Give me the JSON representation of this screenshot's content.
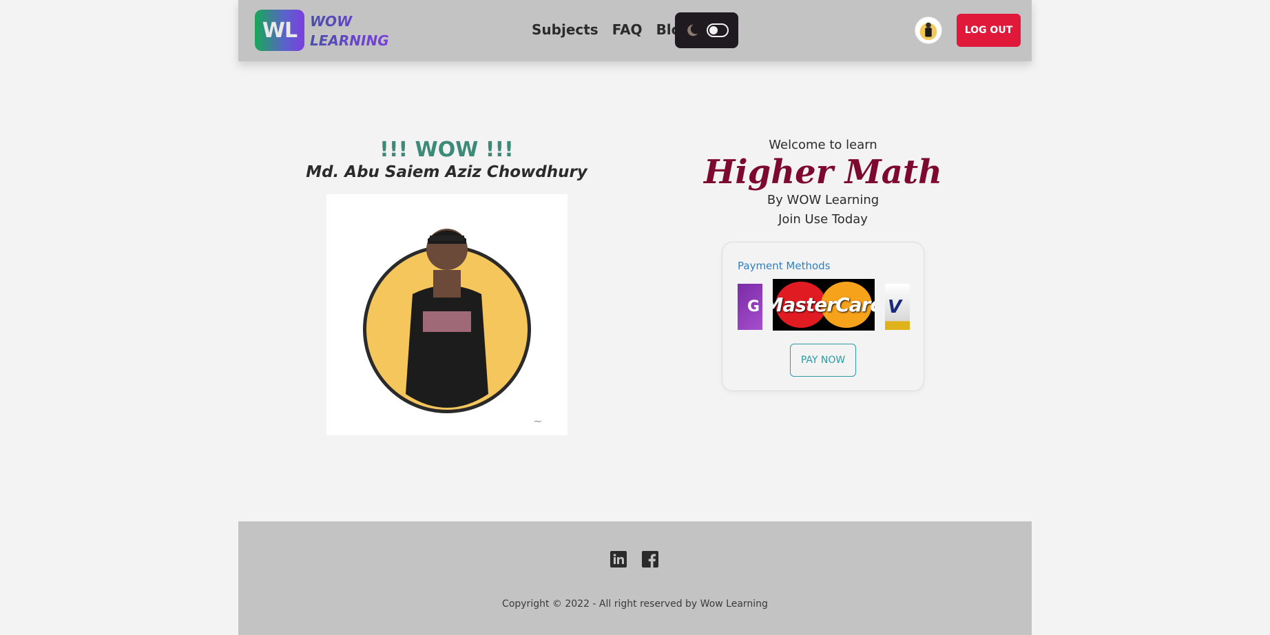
{
  "header": {
    "logo_initials": "WL",
    "brand_line1": "WOW",
    "brand_line2": "LEARNING",
    "nav": [
      "Subjects",
      "FAQ",
      "Blog"
    ],
    "logout_label": "LOG OUT"
  },
  "hero": {
    "wow_title": "!!! WOW !!!",
    "author_name": "Md. Abu Saiem Aziz Chowdhury"
  },
  "course": {
    "welcome": "Welcome to learn",
    "subject": "Higher Math",
    "byline": "By WOW Learning",
    "join": "Join Use Today",
    "payment_label": "Payment Methods",
    "card_main": "MasterCard",
    "pay_now_label": "PAY NOW"
  },
  "footer": {
    "social": [
      "linkedin-icon",
      "facebook-icon"
    ],
    "copyright": "Copyright © 2022 - All right reserved by Wow Learning"
  },
  "colors": {
    "navbar_bg": "#c3c3c3",
    "logout_bg": "#e0183a",
    "subject_color": "#7d0a2e",
    "wow_color": "#3e8a78",
    "pay_color": "#2a9aa3"
  }
}
